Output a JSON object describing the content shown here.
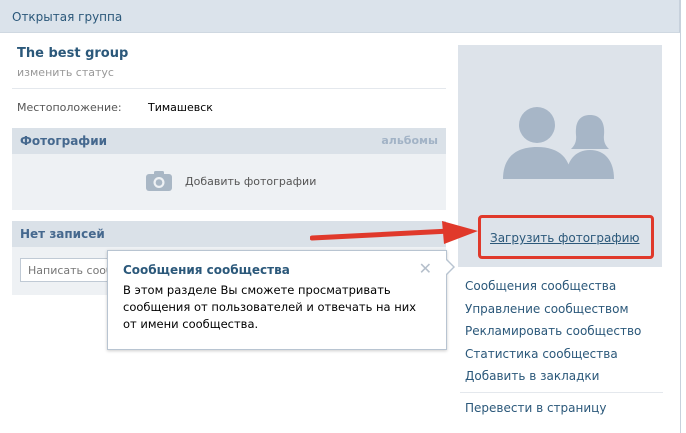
{
  "header": {
    "title": "Открытая группа"
  },
  "group": {
    "name": "The best group",
    "status_link": "изменить статус",
    "location_label": "Местоположение:",
    "location_value": "Тимашевск"
  },
  "photos": {
    "title": "Фотографии",
    "albums_link": "альбомы",
    "add_label": "Добавить фотографии"
  },
  "posts": {
    "title": "Нет записей",
    "input_placeholder": "Написать сооб"
  },
  "avatar": {
    "upload_label": "Загрузить фотографию"
  },
  "menu": {
    "items": [
      "Сообщения сообщества",
      "Управление сообществом",
      "Рекламировать сообщество",
      "Статистика сообщества",
      "Добавить в закладки"
    ],
    "last": "Перевести в страницу"
  },
  "tooltip": {
    "title": "Сообщения сообщества",
    "text": "В этом разделе Вы сможете просматривать сообщения от пользователей и отвечать на них от имени сообщества.",
    "close": "✕"
  },
  "colors": {
    "link": "#2b587a",
    "header_bg": "#dbe3eb",
    "highlight": "#e0392b"
  }
}
